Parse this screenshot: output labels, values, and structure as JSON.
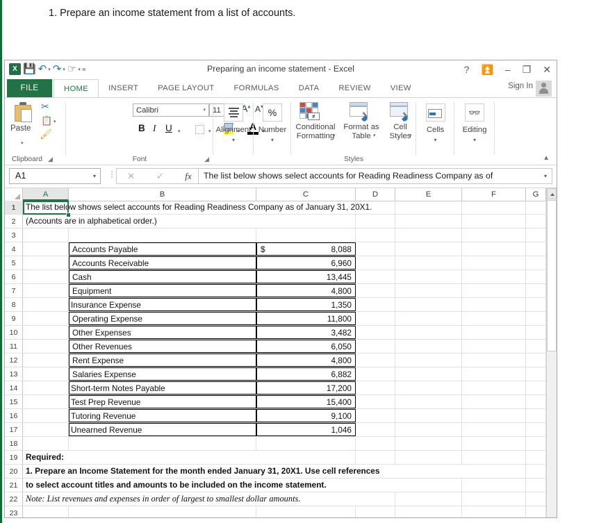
{
  "question": "1. Prepare an income statement from a list of accounts.",
  "window": {
    "title": "Preparing an income statement - Excel",
    "logo": "excel-logo",
    "quick_access": [
      "save-icon",
      "undo-icon",
      "redo-icon",
      "touch-mode-icon",
      "customize-qat-icon"
    ],
    "buttons": [
      "?",
      "ribbon-display-options",
      "minimize",
      "restore",
      "close"
    ],
    "sign_in": "Sign In"
  },
  "tabs": {
    "file": "FILE",
    "items": [
      {
        "label": "HOME",
        "active": true
      },
      {
        "label": "INSERT",
        "active": false
      },
      {
        "label": "PAGE LAYOUT",
        "active": false
      },
      {
        "label": "FORMULAS",
        "active": false
      },
      {
        "label": "DATA",
        "active": false
      },
      {
        "label": "REVIEW",
        "active": false
      },
      {
        "label": "VIEW",
        "active": false
      }
    ]
  },
  "ribbon": {
    "groups": [
      {
        "name": "Clipboard"
      },
      {
        "name": "Font"
      },
      {
        "name": "Styles"
      }
    ],
    "paste": "Paste",
    "font_name": "Calibri",
    "font_size": "11",
    "bold": "B",
    "italic": "I",
    "underline": "U",
    "alignment": "Alignment",
    "number": "Number",
    "conditional_formatting": "Conditional Formatting",
    "format_as_table": "Format as Table",
    "cell_styles": "Cell Styles",
    "cells": "Cells",
    "editing": "Editing",
    "collapse": "collapse-ribbon"
  },
  "formula_bar": {
    "name_box": "A1",
    "cancel": "cancel-icon",
    "enter": "enter-icon",
    "fx": "fx",
    "content": "The list below shows select accounts for Reading Readiness Company as of"
  },
  "sheet": {
    "columns": [
      "A",
      "B",
      "C",
      "D",
      "E",
      "F",
      "G"
    ],
    "selected_column": "A",
    "selected_row": "1",
    "rows": [
      {
        "n": "1",
        "a": "The list below shows select accounts for Reading Readiness Company as of January 31, 20X1.",
        "b": "",
        "c": ""
      },
      {
        "n": "2",
        "a": "(Accounts are in alphabetical order.)",
        "b": "",
        "c": ""
      },
      {
        "n": "3",
        "a": "",
        "b": "",
        "c": ""
      },
      {
        "n": "4",
        "a": "",
        "b": "Accounts Payable",
        "c": "8,088",
        "currency": "$"
      },
      {
        "n": "5",
        "a": "",
        "b": "Accounts Receivable",
        "c": "6,960"
      },
      {
        "n": "6",
        "a": "",
        "b": "Cash",
        "c": "13,445"
      },
      {
        "n": "7",
        "a": "",
        "b": "Equipment",
        "c": "4,800"
      },
      {
        "n": "8",
        "a": "",
        "b": "Insurance Expense",
        "c": "1,350"
      },
      {
        "n": "9",
        "a": "",
        "b": "Operating Expense",
        "c": "11,800"
      },
      {
        "n": "10",
        "a": "",
        "b": "Other Expenses",
        "c": "3,482"
      },
      {
        "n": "11",
        "a": "",
        "b": "Other Revenues",
        "c": "6,050"
      },
      {
        "n": "12",
        "a": "",
        "b": "Rent Expense",
        "c": "4,800"
      },
      {
        "n": "13",
        "a": "",
        "b": "Salaries Expense",
        "c": "6,882"
      },
      {
        "n": "14",
        "a": "",
        "b": "Short-term Notes Payable",
        "c": "17,200"
      },
      {
        "n": "15",
        "a": "",
        "b": "Test Prep Revenue",
        "c": "15,400"
      },
      {
        "n": "16",
        "a": "",
        "b": "Tutoring Revenue",
        "c": "9,100"
      },
      {
        "n": "17",
        "a": "",
        "b": "Unearned Revenue",
        "c": "1,046"
      },
      {
        "n": "18",
        "a": "",
        "b": "",
        "c": ""
      },
      {
        "n": "19",
        "a": "Required:",
        "b": "",
        "c": ""
      },
      {
        "n": "20",
        "a": "1. Prepare an Income Statement for the month ended January 31, 20X1.  Use cell references",
        "b": "",
        "c": ""
      },
      {
        "n": "21",
        "a": "to select account titles and amounts to be included on the income statement.",
        "b": "",
        "c": ""
      },
      {
        "n": "22",
        "a": "Note:  List revenues and expenses in order of largest to smallest dollar amounts.",
        "b": "",
        "c": ""
      },
      {
        "n": "23",
        "a": "",
        "b": "",
        "c": ""
      }
    ]
  },
  "colors": {
    "excel_green": "#217346",
    "accent_blue": "#2e75b6"
  }
}
